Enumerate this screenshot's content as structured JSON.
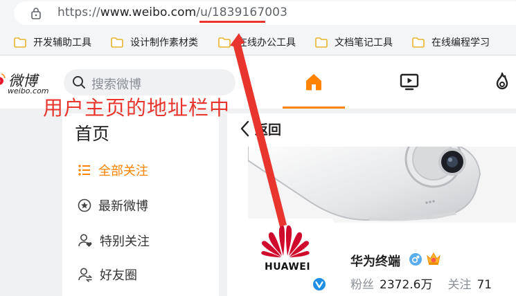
{
  "browser": {
    "url_scheme": "https://",
    "url_host": "www.weibo.com",
    "url_path": "/u/",
    "url_uid": "1839167003"
  },
  "bookmarks": [
    {
      "label": "开发辅助工具"
    },
    {
      "label": "设计制作素材类"
    },
    {
      "label": "在线办公工具"
    },
    {
      "label": "文档笔记工具"
    },
    {
      "label": "在线编程学习"
    }
  ],
  "weibo": {
    "logo_text": "微博",
    "logo_subtext": "weibo.com",
    "search_placeholder": "搜索微博",
    "nav_tabs": [
      {
        "name": "home-icon",
        "active": true
      },
      {
        "name": "video-icon",
        "active": false
      },
      {
        "name": "hot-icon",
        "active": false
      }
    ]
  },
  "annotation": {
    "text": "用户主页的地址栏中",
    "color": "#e8352d"
  },
  "sidebar": {
    "title": "首页",
    "items": [
      {
        "label": "全部关注",
        "icon": "list-icon",
        "active": true
      },
      {
        "label": "最新微博",
        "icon": "star-circle-icon",
        "active": false
      },
      {
        "label": "特别关注",
        "icon": "user-heart-icon",
        "active": false
      },
      {
        "label": "好友圈",
        "icon": "user-friends-icon",
        "active": false
      }
    ]
  },
  "profile": {
    "back_label": "返回",
    "brand_word": "HUAWEI",
    "name": "华为终端",
    "fans_label": "粉丝",
    "fans_value": "2372.6万",
    "follow_label": "关注",
    "follow_value": "71"
  },
  "colors": {
    "accent": "#ff8200",
    "huawei_red": "#cf0a2c",
    "verified_blue": "#1f8fe6"
  }
}
